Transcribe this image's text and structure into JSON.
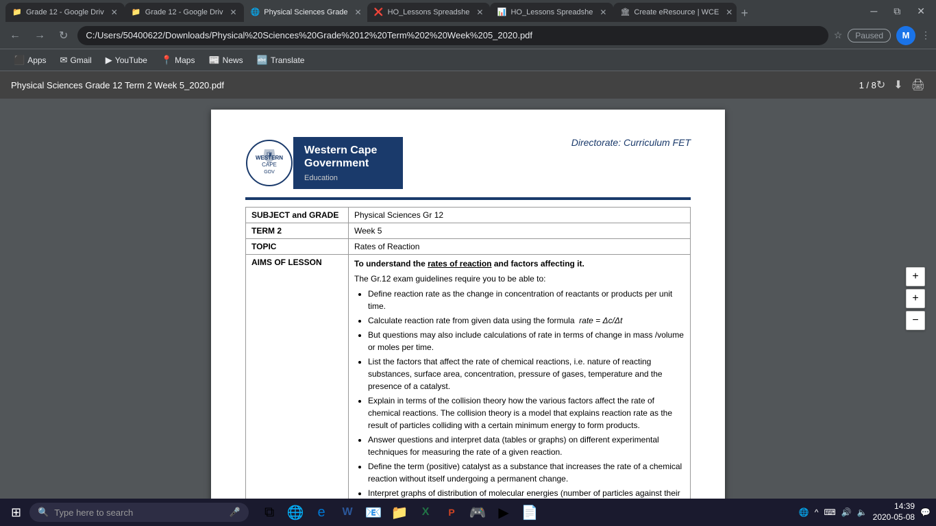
{
  "browser": {
    "tabs": [
      {
        "id": 1,
        "label": "Grade 12 - Google Driv",
        "favicon": "📁",
        "active": false
      },
      {
        "id": 2,
        "label": "Grade 12 - Google Driv",
        "favicon": "📁",
        "active": false
      },
      {
        "id": 3,
        "label": "Physical Sciences Grade",
        "favicon": "🌐",
        "active": true
      },
      {
        "id": 4,
        "label": "HO_Lessons Spreadshe",
        "favicon": "❌",
        "active": false
      },
      {
        "id": 5,
        "label": "HO_Lessons Spreadshe",
        "favicon": "📊",
        "active": false
      },
      {
        "id": 6,
        "label": "Create eResource | WCE",
        "favicon": "🏛",
        "active": false
      }
    ],
    "address": "C:/Users/50400622/Downloads/Physical%20Sciences%20Grade%2012%20Term%202%20Week%205_2020.pdf",
    "profile_letter": "M",
    "paused_label": "Paused"
  },
  "bookmarks": [
    {
      "label": "Apps",
      "icon": "⬛"
    },
    {
      "label": "Gmail",
      "icon": "✉"
    },
    {
      "label": "YouTube",
      "icon": "▶"
    },
    {
      "label": "Maps",
      "icon": "📍"
    },
    {
      "label": "News",
      "icon": "📰"
    },
    {
      "label": "Translate",
      "icon": "🔤"
    }
  ],
  "pdf": {
    "title": "Physical Sciences Grade 12 Term 2 Week 5_2020.pdf",
    "page_info": "1 / 8",
    "wcg": {
      "main_line1": "Western Cape",
      "main_line2": "Government",
      "education_label": "Education",
      "directorate": "Directorate: Curriculum FET"
    },
    "table": {
      "rows": [
        {
          "label": "SUBJECT and GRADE",
          "value": "Physical Sciences Gr 12"
        },
        {
          "label": "TERM 2",
          "value": "Week 5"
        },
        {
          "label": "TOPIC",
          "value": "Rates of Reaction"
        },
        {
          "label": "AIMS OF LESSON",
          "value_html": true
        }
      ]
    },
    "aims": {
      "heading": "To understand the rates of reaction and factors affecting it.",
      "intro": "The Gr.12 exam guidelines require you to be able to:",
      "bullets": [
        "Define reaction rate as the change in concentration of reactants or products per unit time.",
        "Calculate reaction rate from given data using the formula  rate = Δc/Δt",
        "But questions may also include calculations of rate in terms of change in mass /volume or moles per time.",
        "List the factors that affect the rate of chemical reactions, i.e. nature of reacting substances, surface area, concentration, pressure of gases, temperature and the presence of a catalyst.",
        "Explain in terms of the collision theory how the various factors affect the rate of chemical reactions.  The collision theory is a model that explains reaction rate as the result of particles colliding with a certain minimum energy to form products.",
        "Answer questions and interpret data (tables or graphs) on different experimental techniques for measuring the rate of a given reaction.",
        "Define the term (positive) catalyst as a substance that increases the rate of a chemical reaction without itself undergoing a permanent change.",
        "Interpret graphs of distribution of molecular energies (number of particles against their kinetic energy also known as Maxwell-Boltzmann curves) to explain how a catalyst, temperature and"
      ]
    }
  },
  "taskbar": {
    "search_placeholder": "Type here to search",
    "time": "14:39",
    "date": "2020-05-08",
    "apps": [
      {
        "name": "windows-start",
        "icon": "⊞"
      },
      {
        "name": "search",
        "icon": "🔍"
      },
      {
        "name": "task-view",
        "icon": "⧉"
      },
      {
        "name": "chrome",
        "icon": "🌐"
      },
      {
        "name": "edge",
        "icon": "🔵"
      },
      {
        "name": "word",
        "icon": "W"
      },
      {
        "name": "outlook",
        "icon": "📧"
      },
      {
        "name": "file-explorer",
        "icon": "📁"
      },
      {
        "name": "excel",
        "icon": "📊"
      },
      {
        "name": "powerpoint",
        "icon": "📑"
      },
      {
        "name": "unknown1",
        "icon": "🎮"
      },
      {
        "name": "unknown2",
        "icon": "▶"
      },
      {
        "name": "pdf",
        "icon": "📄"
      }
    ]
  },
  "zoom": {
    "plus_label": "+",
    "minus_label": "−"
  }
}
